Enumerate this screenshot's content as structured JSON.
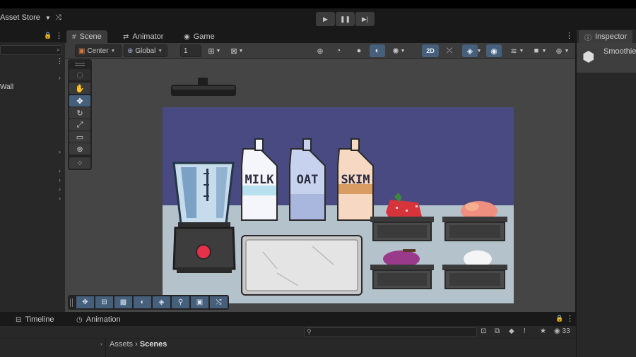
{
  "toolbar": {
    "asset_store_label": "Asset Store",
    "play_icons": [
      "play-icon",
      "pause-icon",
      "step-icon"
    ]
  },
  "hierarchy": {
    "item_partial": "Wall"
  },
  "scene_tabs": [
    {
      "label": "Scene",
      "icon": "grid-icon",
      "active": true
    },
    {
      "label": "Animator",
      "icon": "animator-icon",
      "active": false
    },
    {
      "label": "Game",
      "icon": "gamepad-icon",
      "active": false
    }
  ],
  "scene_toolbar": {
    "pivot_mode": "Center",
    "pivot_rotation": "Global",
    "grid_size": "1",
    "mode_2d": "2D"
  },
  "inspector": {
    "tab_label": "Inspector",
    "object_name_partial": "Smoothie"
  },
  "scene_content": {
    "bottles": [
      "MILK",
      "OAT",
      "SKIM"
    ]
  },
  "bottom_tabs": [
    {
      "label": "Timeline",
      "icon": "timeline-icon"
    },
    {
      "label": "Animation",
      "icon": "animation-clock-icon"
    }
  ],
  "project": {
    "breadcrumb_root": "Assets",
    "breadcrumb_current": "Scenes",
    "hidden_count": "33"
  },
  "colors": {
    "editor_bg": "#191919",
    "panel_bg": "#282828",
    "accent_blue": "#46607c",
    "scene_sky": "#4a4a82",
    "scene_counter": "#b4c2cc"
  }
}
